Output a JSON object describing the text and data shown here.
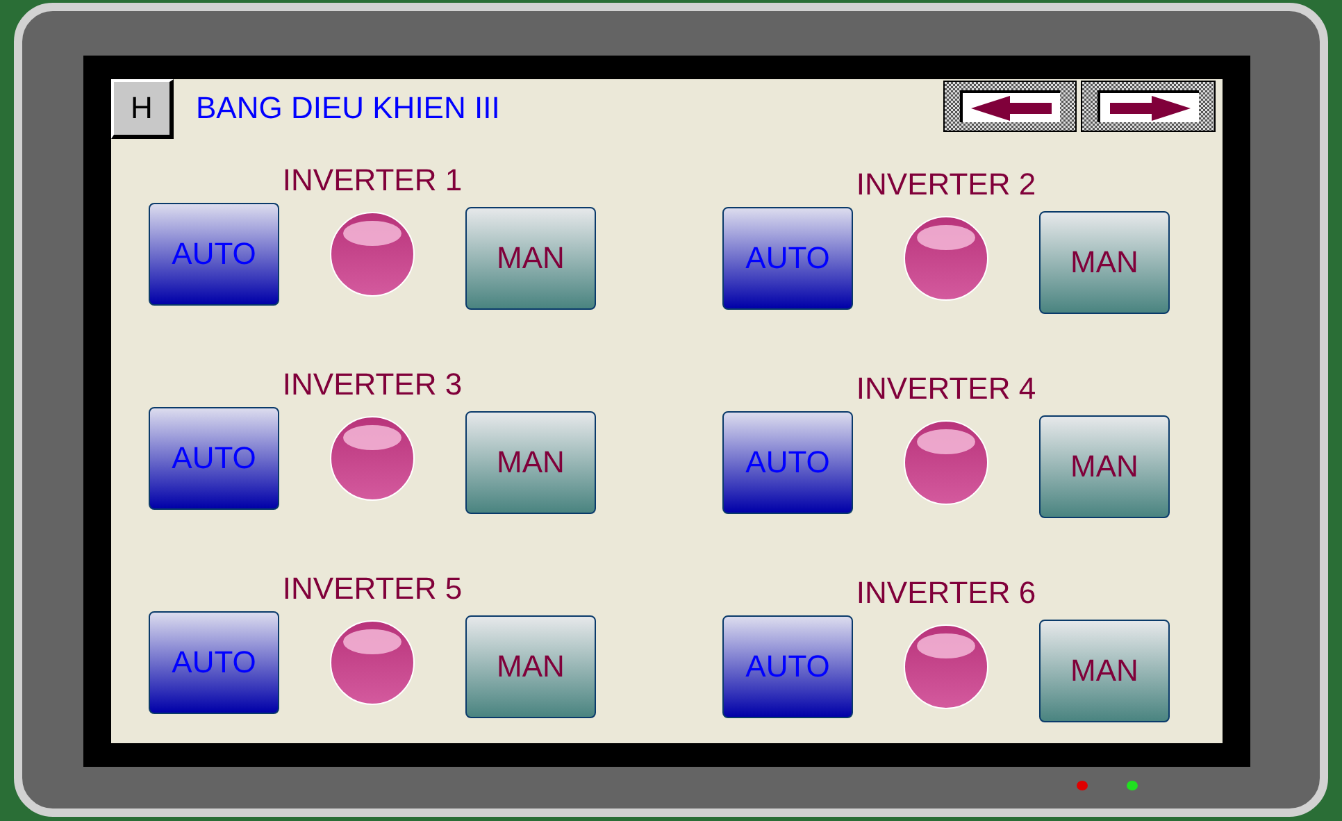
{
  "header": {
    "home_button": "H",
    "title": "BANG DIEU KHIEN III"
  },
  "nav_buttons": [
    {
      "kind": "back"
    },
    {
      "kind": "forward"
    }
  ],
  "inverters": [
    {
      "label": "INVERTER 1",
      "auto": "AUTO",
      "manual": "MAN",
      "lamp_on": false
    },
    {
      "label": "INVERTER 2",
      "auto": "AUTO",
      "manual": "MAN",
      "lamp_on": false
    },
    {
      "label": "INVERTER 3",
      "auto": "AUTO",
      "manual": "MAN",
      "lamp_on": false
    },
    {
      "label": "INVERTER 4",
      "auto": "AUTO",
      "manual": "MAN",
      "lamp_on": false
    },
    {
      "label": "INVERTER 5",
      "auto": "AUTO",
      "manual": "MAN",
      "lamp_on": false
    },
    {
      "label": "INVERTER 6",
      "auto": "AUTO",
      "manual": "MAN",
      "lamp_on": false
    }
  ],
  "indicators": [
    {
      "color": "#e00000"
    },
    {
      "color": "#20e020"
    }
  ]
}
